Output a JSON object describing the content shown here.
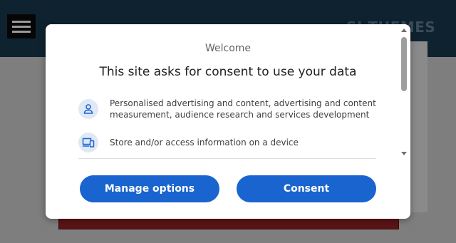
{
  "site": {
    "logo_text": "SI  THEMES"
  },
  "consent": {
    "welcome": "Welcome",
    "title": "This site asks for consent to use your data",
    "purposes": [
      {
        "icon": "person-icon",
        "text": "Personalised advertising and content, advertising and content measurement, audience research and services development"
      },
      {
        "icon": "devices-icon",
        "text": "Store and/or access information on a device"
      }
    ],
    "manage_label": "Manage options",
    "consent_label": "Consent"
  },
  "colors": {
    "accent": "#1a64d0",
    "header": "#0f2230",
    "icon_bg": "#dfe8f5"
  }
}
